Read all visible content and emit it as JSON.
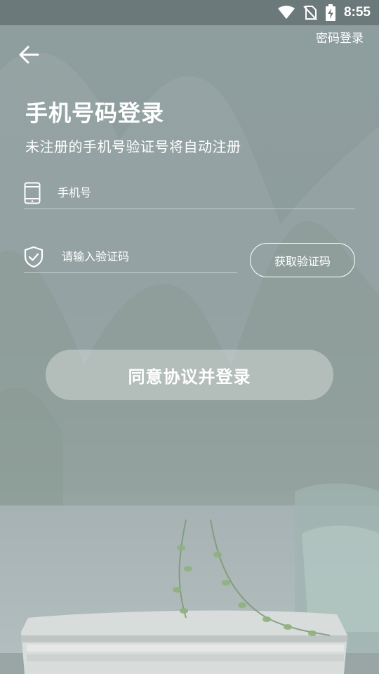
{
  "status_bar": {
    "time": "8:55",
    "icons": [
      "wifi-icon",
      "no-sim-icon",
      "battery-charging-icon"
    ]
  },
  "header": {
    "back_icon": "arrow-left-icon",
    "password_login": "密码登录"
  },
  "main": {
    "title": "手机号码登录",
    "subtitle": "未注册的手机号验证号将自动注册",
    "phone": {
      "icon": "phone-icon",
      "placeholder": "手机号",
      "value": ""
    },
    "code": {
      "icon": "shield-check-icon",
      "placeholder": "请输入验证码",
      "value": ""
    },
    "get_code_label": "获取验证码",
    "login_label": "同意协议并登录"
  },
  "colors": {
    "background": "#8e9d9e",
    "status_bar": "#6c797a",
    "text": "#ffffff"
  }
}
